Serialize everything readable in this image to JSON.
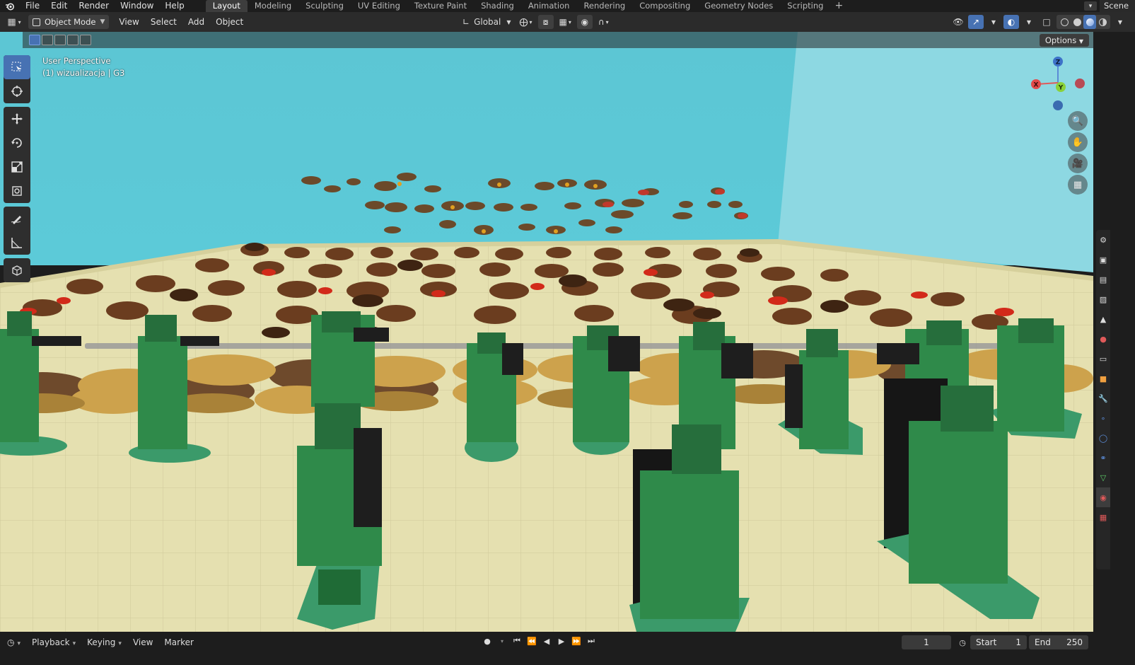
{
  "topbar": {
    "menus": [
      "File",
      "Edit",
      "Render",
      "Window",
      "Help"
    ],
    "workspace_tabs": [
      "Layout",
      "Modeling",
      "Sculpting",
      "UV Editing",
      "Texture Paint",
      "Shading",
      "Animation",
      "Rendering",
      "Compositing",
      "Geometry Nodes",
      "Scripting"
    ],
    "active_tab": "Layout",
    "add_tab": "+",
    "scene_label": "Scene"
  },
  "header": {
    "mode": "Object Mode",
    "menus": [
      "View",
      "Select",
      "Add",
      "Object"
    ],
    "transform_orientation": "Global"
  },
  "viewport": {
    "options_label": "Options",
    "perspective_label": "User Perspective",
    "collection_label": "(1) wizualizacja | G3",
    "gizmo": {
      "z": "Z",
      "y": "Y",
      "x": "X"
    },
    "colors": {
      "sky": "#5ec8d6",
      "floor": "#e4dfae",
      "soldier": "#2f8a4a",
      "base": "#3b9a6a",
      "sandbag": "#c8a24a",
      "accent": "#4772b3"
    }
  },
  "toolbar": {
    "tools": [
      "select-box",
      "cursor",
      "move",
      "rotate",
      "scale",
      "transform",
      "annotate",
      "measure",
      "add-cube"
    ]
  },
  "timeline": {
    "menus": [
      "Playback",
      "Keying",
      "View",
      "Marker"
    ],
    "current_frame": "1",
    "start_label": "Start",
    "start_value": "1",
    "end_label": "End",
    "end_value": "250"
  }
}
